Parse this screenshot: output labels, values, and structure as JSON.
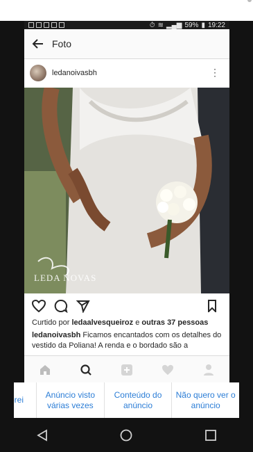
{
  "status_bar": {
    "battery": "59%",
    "time": "19:22"
  },
  "header": {
    "title": "Foto"
  },
  "post": {
    "username": "ledanoivasbh",
    "watermark": "LEDA NOVAS",
    "likes_prefix": "Curtido por",
    "liked_by": "ledaalvesqueiroz",
    "likes_joiner": "e",
    "likes_others": "outras 37 pessoas",
    "caption_user": "ledanoivasbh",
    "caption_text": "Ficamos encantados com os detalhes do vestido da Poliana! A renda e o bordado são a"
  },
  "ad_options": {
    "items": [
      {
        "label": "prei"
      },
      {
        "label": "Anúncio visto várias vezes"
      },
      {
        "label": "Conteúdo do anúncio"
      },
      {
        "label": "Não quero ver o anúncio"
      }
    ]
  },
  "icons": [
    "back-arrow-icon",
    "more-vert-icon",
    "heart-icon",
    "comment-icon",
    "share-icon",
    "bookmark-icon",
    "home-icon",
    "search-icon",
    "add-icon",
    "activity-heart-icon",
    "profile-icon",
    "nav-back-icon",
    "nav-home-icon",
    "nav-recents-icon"
  ],
  "colors": {
    "accent_blue": "#2b7dd6",
    "frame": "#121212",
    "text": "#262626"
  }
}
